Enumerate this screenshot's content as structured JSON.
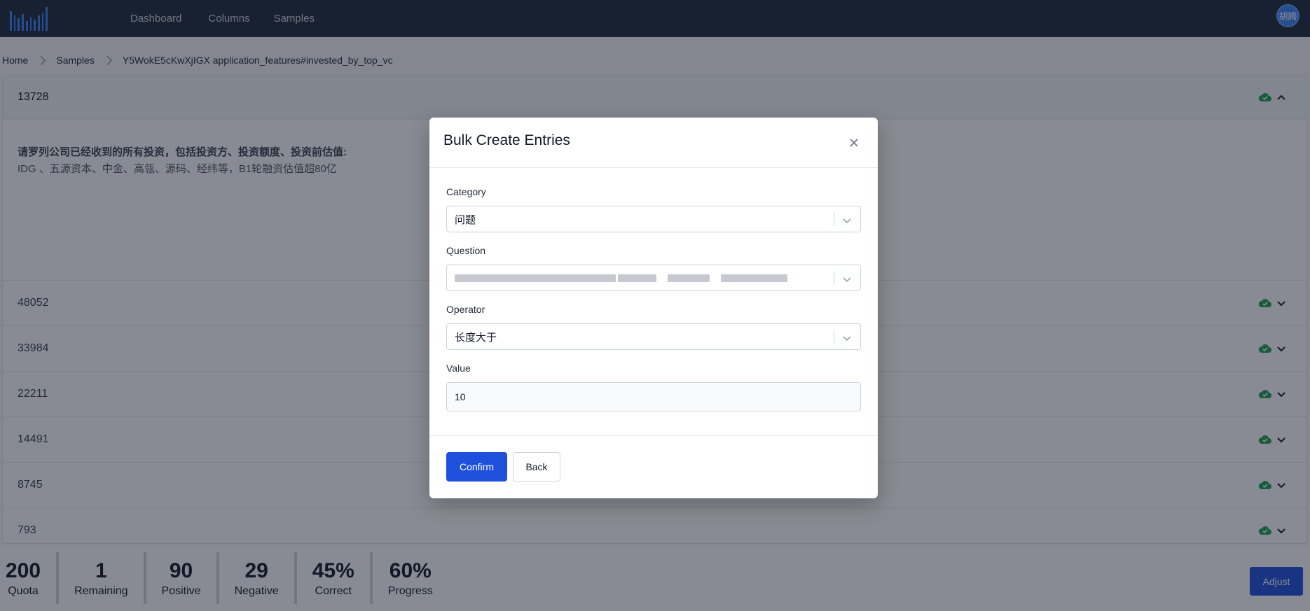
{
  "nav": {
    "links": [
      "Dashboard",
      "Columns",
      "Samples"
    ],
    "user_initials": "胡腾"
  },
  "breadcrumb": [
    "Home",
    "Samples",
    "Y5WokE5cKwXjIGX application_features#invested_by_top_vc"
  ],
  "list": {
    "first_row_id": "13728",
    "expanded": {
      "question": "请罗列公司已经收到的所有投资，包括投资方、投资额度、投资前估值:",
      "answer": "IDG 、五源资本、中金、高瓴、源码、经纬等，B1轮融资估值超80亿"
    },
    "rows": [
      "48052",
      "33984",
      "22211",
      "14491",
      "8745",
      "793"
    ]
  },
  "stats": [
    {
      "value": "200",
      "label": "Quota"
    },
    {
      "value": "1",
      "label": "Remaining"
    },
    {
      "value": "90",
      "label": "Positive"
    },
    {
      "value": "29",
      "label": "Negative"
    },
    {
      "value": "45%",
      "label": "Correct"
    },
    {
      "value": "60%",
      "label": "Progress"
    }
  ],
  "adjust_label": "Adjust",
  "modal": {
    "title": "Bulk Create Entries",
    "category_label": "Category",
    "category_value": "问题",
    "question_label": "Question",
    "operator_label": "Operator",
    "operator_value": "长度大于",
    "value_label": "Value",
    "value_value": "10",
    "confirm_label": "Confirm",
    "back_label": "Back"
  },
  "colors": {
    "nav_bg": "#1f2a3c",
    "primary": "#1e50dc",
    "status_ok": "#22a050"
  },
  "icons": [
    "logo-bars-icon",
    "chevron-right-icon",
    "cloud-check-icon",
    "chevron-up-icon",
    "chevron-down-icon",
    "close-icon"
  ]
}
